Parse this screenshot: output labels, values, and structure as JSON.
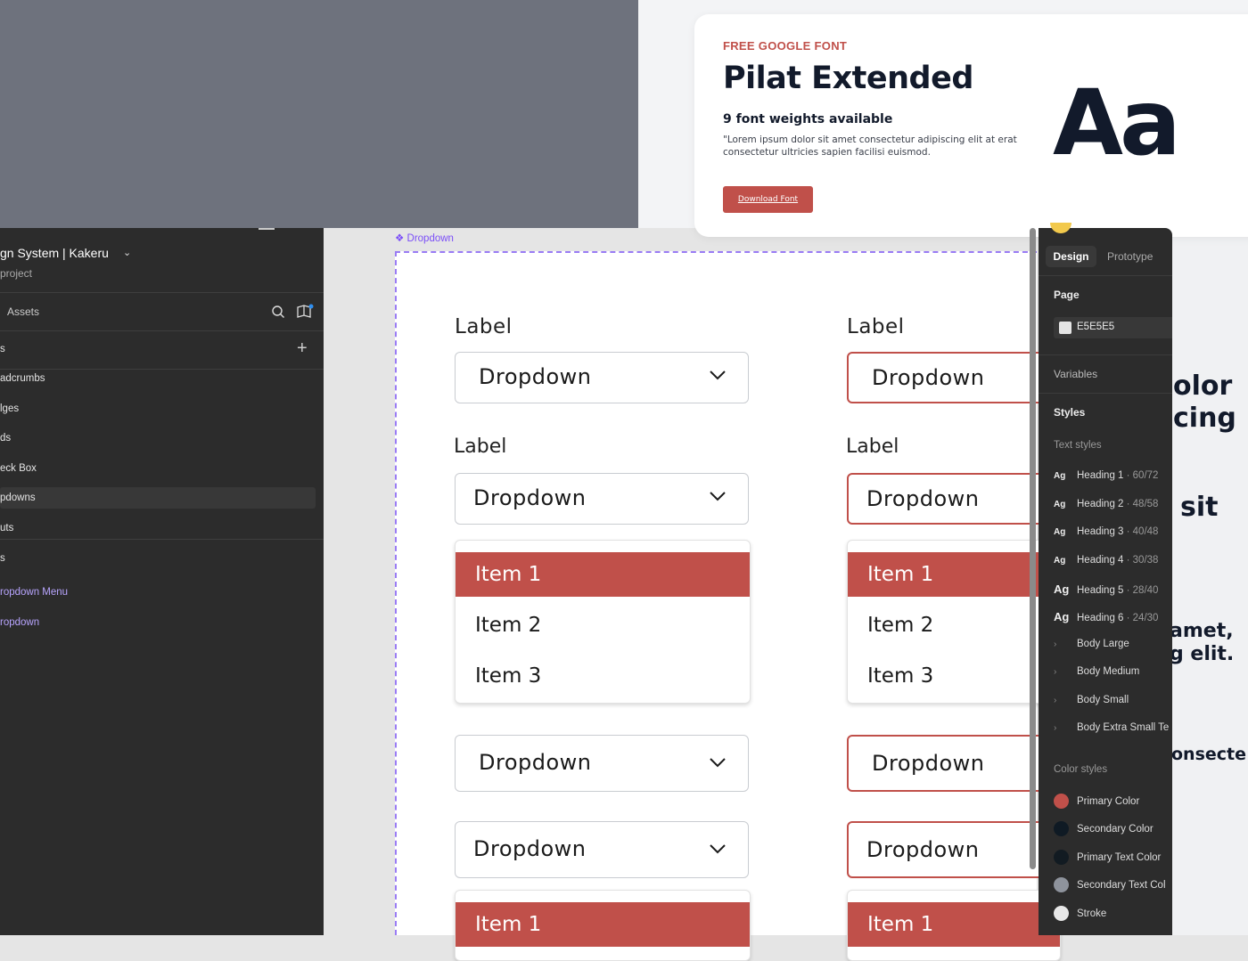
{
  "font_card": {
    "tag": "FREE GOOGLE FONT",
    "name": "Pilat Extended",
    "weights": "9 font weights available",
    "description": "\"Lorem ipsum dolor sit amet consectetur adipiscing elit at erat consectetur ultricies sapien facilisi euismod.",
    "button": "Download Font",
    "sample": "Aa"
  },
  "background_partials": [
    "olor",
    "cing",
    "sit",
    "amet,",
    "g elit.",
    "onsecte"
  ],
  "left_panel": {
    "title": "gn System | Kakeru",
    "subtitle": "project",
    "assets_label": "Assets",
    "section_label": "s",
    "items": [
      "adcrumbs",
      "lges",
      "ds",
      "eck Box",
      "pdowns",
      "uts"
    ],
    "selected_index": 4,
    "section2_label": "s",
    "components": [
      "ropdown Menu",
      "ropdown"
    ]
  },
  "canvas": {
    "frame_label": "Dropdown",
    "columns": [
      {
        "label1": "Label",
        "dd1": "Dropdown",
        "label2": "Label",
        "dd2": "Dropdown",
        "menu1": [
          "Item 1",
          "Item 2",
          "Item 3"
        ],
        "dd3": "Dropdown",
        "dd4": "Dropdown",
        "menu2_first": "Item 1"
      },
      {
        "label1": "Label",
        "dd1": "Dropdown",
        "label2": "Label",
        "dd2": "Dropdown",
        "menu1": [
          "Item 1",
          "Item 2",
          "Item 3"
        ],
        "dd3": "Dropdown",
        "dd4": "Dropdown",
        "menu2_first": "Item 1"
      }
    ]
  },
  "right_panel": {
    "tabs": [
      "Design",
      "Prototype"
    ],
    "page_heading": "Page",
    "page_color": "E5E5E5",
    "variables": "Variables",
    "styles": "Styles",
    "text_styles_heading": "Text styles",
    "text_styles": [
      {
        "ag": "Ag",
        "name": "Heading 1",
        "size": " · 60/72"
      },
      {
        "ag": "Ag",
        "name": "Heading 2",
        "size": " · 48/58"
      },
      {
        "ag": "Ag",
        "name": "Heading 3",
        "size": " · 40/48"
      },
      {
        "ag": "Ag",
        "name": "Heading 4",
        "size": " · 30/38"
      },
      {
        "ag": "Ag",
        "name": "Heading 5",
        "size": " · 28/40"
      },
      {
        "ag": "Ag",
        "name": "Heading 6",
        "size": " · 24/30"
      }
    ],
    "body_styles": [
      "Body Large",
      "Body Medium",
      "Body Small",
      "Body Extra Small Te"
    ],
    "color_styles_heading": "Color styles",
    "color_styles": [
      {
        "name": "Primary Color",
        "color": "#c0504a"
      },
      {
        "name": "Secondary Color",
        "color": "#0f1a24"
      },
      {
        "name": "Primary Text Color",
        "color": "#121b22"
      },
      {
        "name": "Secondary Text Col",
        "color": "#8e939c"
      },
      {
        "name": "Stroke",
        "color": "#e8e8e8"
      }
    ]
  },
  "colors": {
    "primary": "#c0504a",
    "dark": "#2c2c2c",
    "accent_purple": "#7b4ef8"
  }
}
